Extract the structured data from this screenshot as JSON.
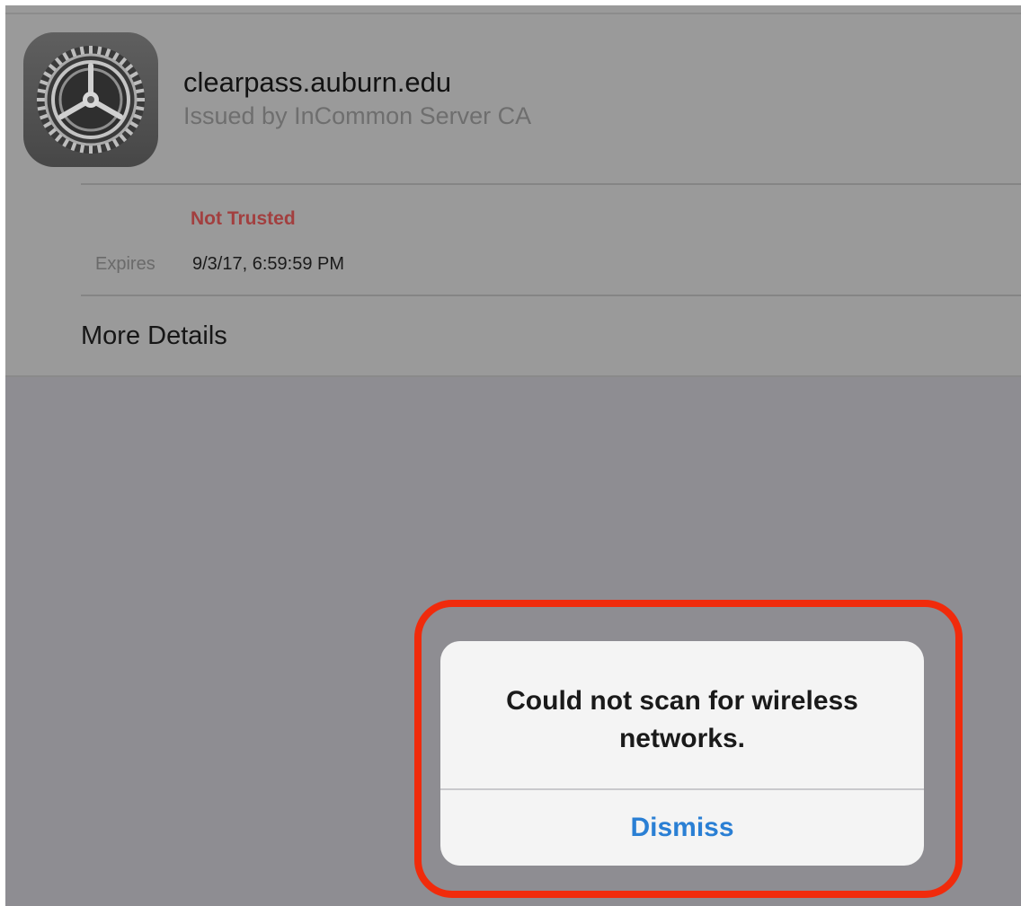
{
  "certificate": {
    "icon": "settings-gear-icon",
    "name": "clearpass.auburn.edu",
    "issuer": "Issued by InCommon Server CA",
    "trust_status": "Not Trusted",
    "expires_label": "Expires",
    "expires_value": "9/3/17, 6:59:59 PM",
    "more_details": "More Details"
  },
  "alert": {
    "title": "Could not scan for wireless networks.",
    "dismiss_label": "Dismiss"
  },
  "colors": {
    "not_trusted": "#a23f3f",
    "button_blue": "#2a7fd4",
    "highlight_red": "#f02b0c"
  }
}
